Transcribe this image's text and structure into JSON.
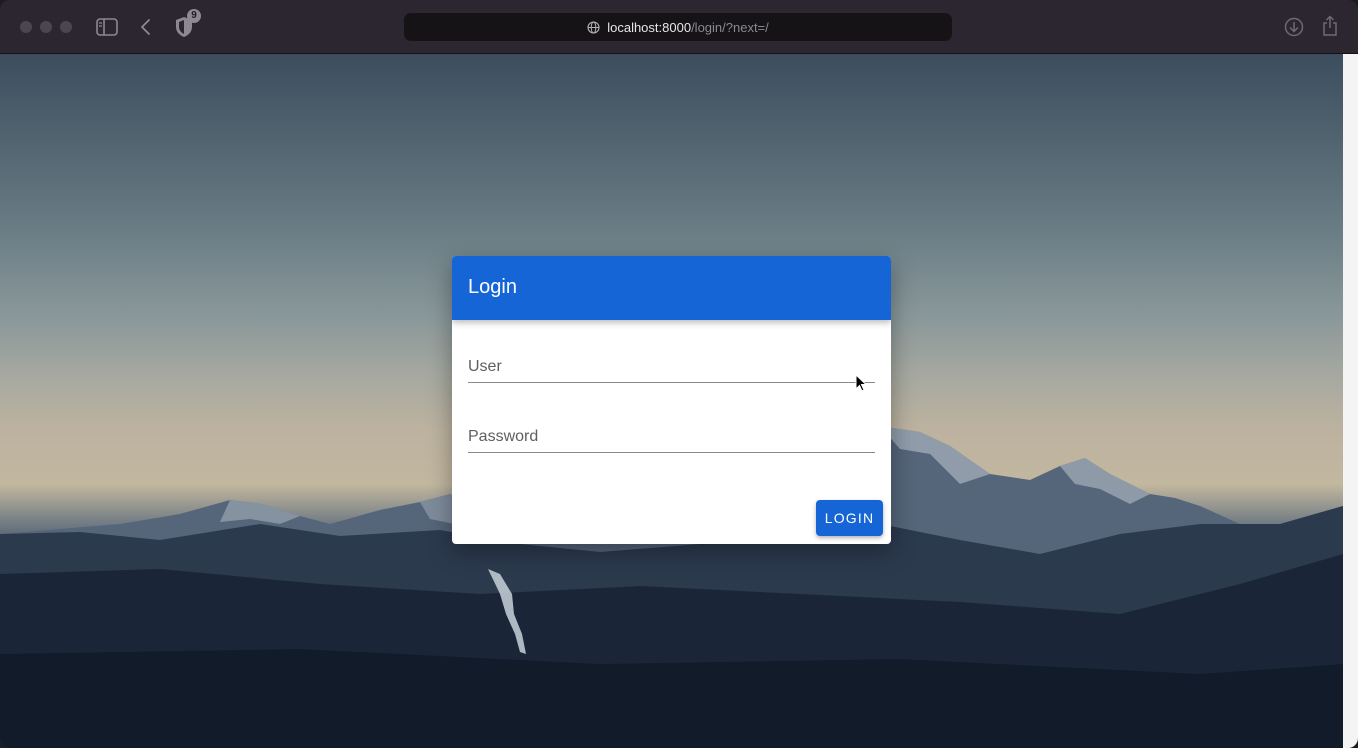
{
  "browser": {
    "tracker_badge_count": "9",
    "url": {
      "host": "localhost:8000",
      "path": "/login/?next=/"
    },
    "icons": {
      "sidebar": "sidebar-icon",
      "back": "chevron-left-icon",
      "privacy": "shield-icon",
      "site": "globe-icon",
      "download": "download-icon",
      "share": "share-icon"
    }
  },
  "login_card": {
    "title": "Login",
    "user_field": {
      "label": "User",
      "value": ""
    },
    "password_field": {
      "label": "Password",
      "value": ""
    },
    "submit_label": "LOGIN",
    "accent_color": "#1565d6"
  }
}
